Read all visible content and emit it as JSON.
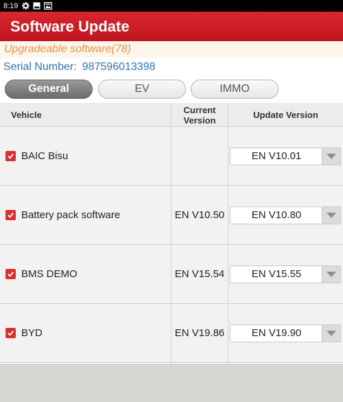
{
  "status_bar": {
    "time": "8:19",
    "icons": [
      "settings-gear-icon",
      "image-icon",
      "gallery-icon"
    ]
  },
  "app_bar": {
    "title": "Software Update"
  },
  "info": {
    "upgradeable": "Upgradeable software(78)",
    "serial_label": "Serial Number:",
    "serial_value": "987596013398"
  },
  "tabs": [
    {
      "label": "General",
      "active": true
    },
    {
      "label": "EV",
      "active": false
    },
    {
      "label": "IMMO",
      "active": false
    }
  ],
  "table": {
    "headers": {
      "vehicle": "Vehicle",
      "current": "Current Version",
      "update": "Update Version"
    },
    "rows": [
      {
        "vehicle": "BAIC Bisu",
        "current": "",
        "update": "EN V10.01",
        "checked": true
      },
      {
        "vehicle": "Battery pack software",
        "current": "EN V10.50",
        "update": "EN V10.80",
        "checked": true
      },
      {
        "vehicle": "BMS DEMO",
        "current": "EN V15.54",
        "update": "EN V15.55",
        "checked": true
      },
      {
        "vehicle": "BYD",
        "current": "EN V19.86",
        "update": "EN V19.90",
        "checked": true
      }
    ]
  },
  "colors": {
    "accent_red": "#c81c26",
    "link_blue": "#2d73b8",
    "upgradeable_orange": "#e8924a"
  }
}
